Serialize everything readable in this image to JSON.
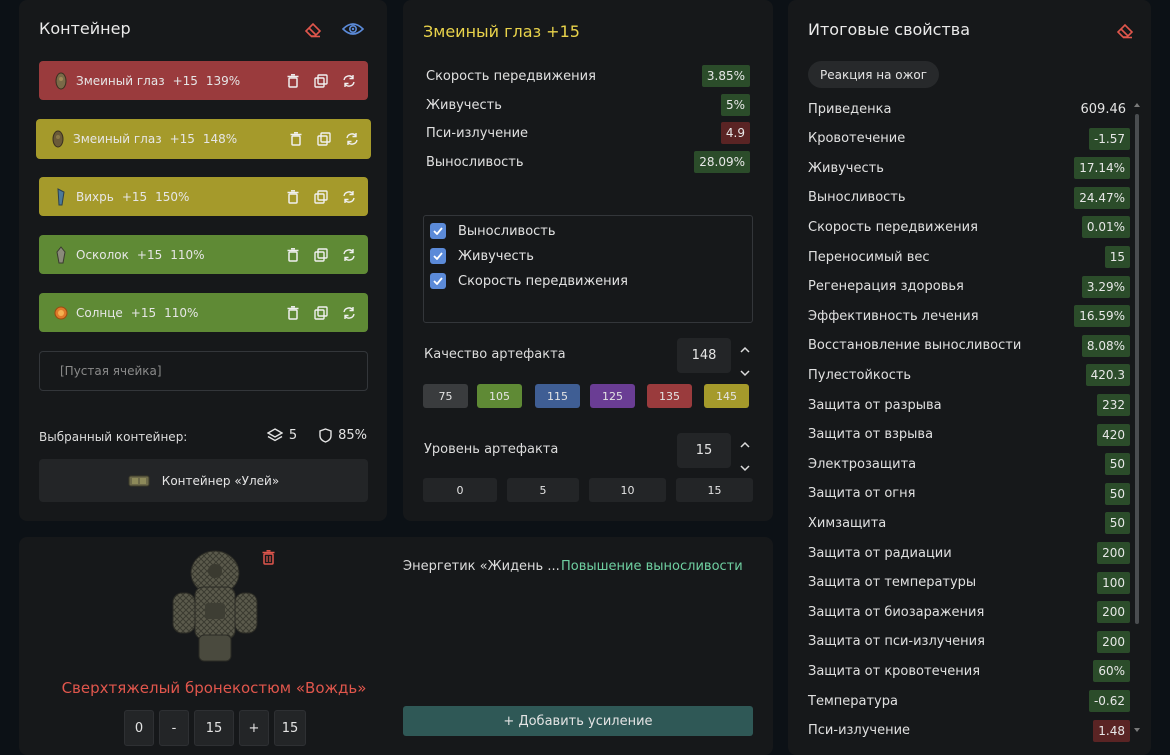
{
  "container": {
    "title": "Контейнер",
    "artifacts": [
      {
        "name": "Змеиный глаз",
        "level": "+15",
        "quality": "139%",
        "color": "#9a3b3d"
      },
      {
        "name": "Змеиный глаз",
        "level": "+15",
        "quality": "148%",
        "color": "#a59a2b"
      },
      {
        "name": "Вихрь",
        "level": "+15",
        "quality": "150%",
        "color": "#a59a2b"
      },
      {
        "name": "Осколок",
        "level": "+15",
        "quality": "110%",
        "color": "#5f8a35"
      },
      {
        "name": "Солнце",
        "level": "+15",
        "quality": "110%",
        "color": "#5f8a35"
      }
    ],
    "empty_slot": "[Пустая ячейка]",
    "selected_label": "Выбранный контейнер:",
    "slots": "5",
    "protection": "85%",
    "container_name": "Контейнер «Улей»"
  },
  "artifact": {
    "title": "Змеиный глаз +15",
    "title_color": "#e9d34b",
    "stats": [
      {
        "name": "Скорость передвижения",
        "value": "3.85%",
        "tone": "green"
      },
      {
        "name": "Живучесть",
        "value": "5%",
        "tone": "green"
      },
      {
        "name": "Пси-излучение",
        "value": "4.9",
        "tone": "red"
      },
      {
        "name": "Выносливость",
        "value": "28.09%",
        "tone": "green"
      }
    ],
    "checks": [
      "Выносливость",
      "Живучесть",
      "Скорость передвижения"
    ],
    "quality_label": "Качество артефакта",
    "quality_value": "148",
    "quality_presets": [
      {
        "label": "75",
        "color": "#3a3c3e"
      },
      {
        "label": "105",
        "color": "#5f8a35"
      },
      {
        "label": "115",
        "color": "#3f5e94"
      },
      {
        "label": "125",
        "color": "#6a3d94"
      },
      {
        "label": "135",
        "color": "#9a3b3d"
      },
      {
        "label": "145",
        "color": "#a59a2b"
      }
    ],
    "level_label": "Уровень артефакта",
    "level_value": "15",
    "level_presets": [
      "0",
      "5",
      "10",
      "15"
    ]
  },
  "totals": {
    "title": "Итоговые свойства",
    "tag": "Реакция на ожог",
    "rows": [
      {
        "name": "Приведенка",
        "value": "609.46",
        "tone": "plain"
      },
      {
        "name": "Кровотечение",
        "value": "-1.57",
        "tone": "green"
      },
      {
        "name": "Живучесть",
        "value": "17.14%",
        "tone": "green"
      },
      {
        "name": "Выносливость",
        "value": "24.47%",
        "tone": "green"
      },
      {
        "name": "Скорость передвижения",
        "value": "0.01%",
        "tone": "green"
      },
      {
        "name": "Переносимый вес",
        "value": "15",
        "tone": "green"
      },
      {
        "name": "Регенерация здоровья",
        "value": "3.29%",
        "tone": "green"
      },
      {
        "name": "Эффективность лечения",
        "value": "16.59%",
        "tone": "green"
      },
      {
        "name": "Восстановление выносливости",
        "value": "8.08%",
        "tone": "green"
      },
      {
        "name": "Пулестойкость",
        "value": "420.3",
        "tone": "green"
      },
      {
        "name": "Защита от разрыва",
        "value": "232",
        "tone": "green"
      },
      {
        "name": "Защита от взрыва",
        "value": "420",
        "tone": "green"
      },
      {
        "name": "Электрозащита",
        "value": "50",
        "tone": "green"
      },
      {
        "name": "Защита от огня",
        "value": "50",
        "tone": "green"
      },
      {
        "name": "Химзащита",
        "value": "50",
        "tone": "green"
      },
      {
        "name": "Защита от радиации",
        "value": "200",
        "tone": "green"
      },
      {
        "name": "Защита от температуры",
        "value": "100",
        "tone": "green"
      },
      {
        "name": "Защита от биозаражения",
        "value": "200",
        "tone": "green"
      },
      {
        "name": "Защита от пси-излучения",
        "value": "200",
        "tone": "green"
      },
      {
        "name": "Защита от кровотечения",
        "value": "60%",
        "tone": "green"
      },
      {
        "name": "Температура",
        "value": "-0.62",
        "tone": "green"
      },
      {
        "name": "Пси-излучение",
        "value": "1.48",
        "tone": "red"
      }
    ]
  },
  "armor": {
    "name": "Сверхтяжелый бронекостюм «Вождь»",
    "level_min": "0",
    "minus": "-",
    "level": "15",
    "plus": "+",
    "level_max": "15",
    "boost_name": "Энергетик «Жидень ...",
    "boost_effect": "Повышение выносливости",
    "add_button": "+ Добавить усиление"
  }
}
